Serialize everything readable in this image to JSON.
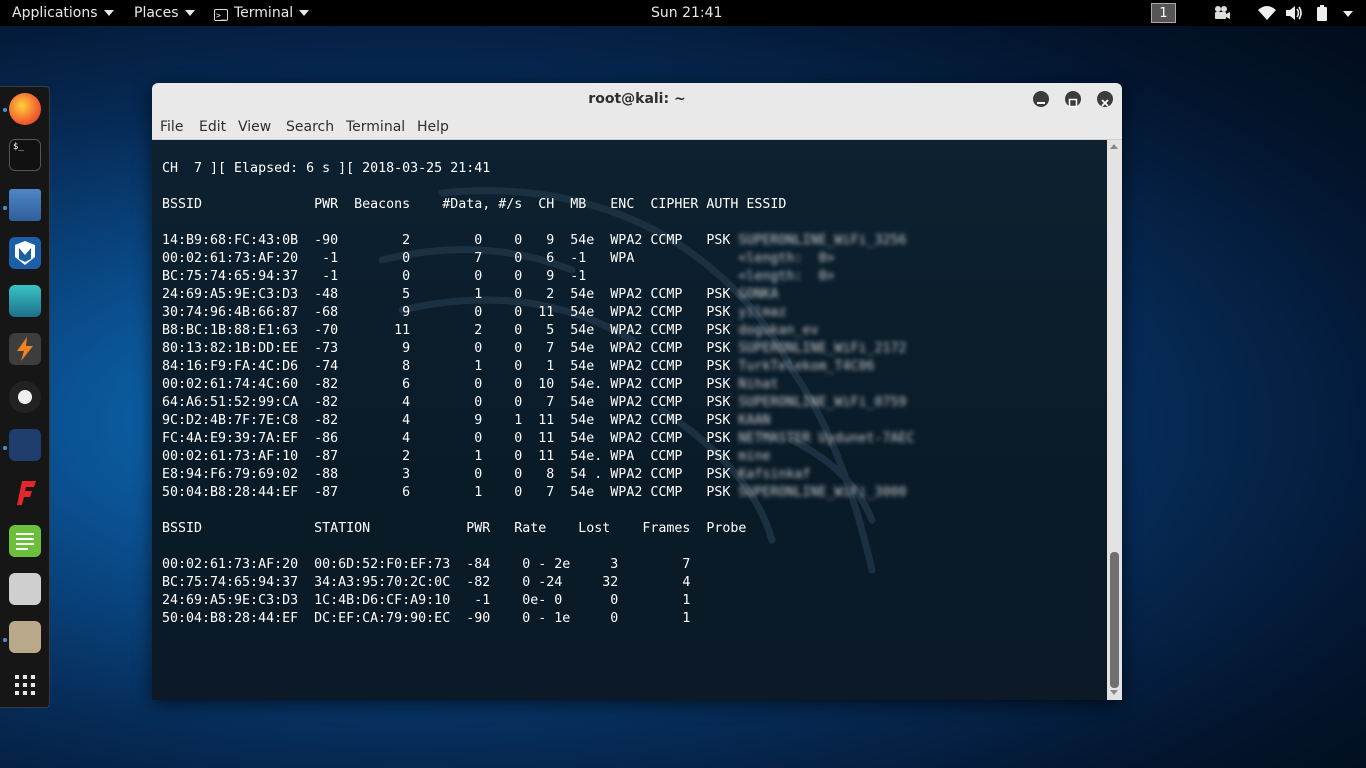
{
  "topbar": {
    "applications": "Applications",
    "places": "Places",
    "terminal": "Terminal",
    "clock": "Sun 21:41",
    "workspace": "1",
    "tray_icons": [
      "video-icon",
      "wifi-icon",
      "volume-icon",
      "battery-icon",
      "power-menu-icon"
    ]
  },
  "dock": {
    "items": [
      "firefox-icon",
      "terminal-icon",
      "files-icon",
      "metasploit-icon",
      "armitage-icon",
      "burpsuite-icon",
      "maltego-icon",
      "beef-icon",
      "faraday-icon",
      "leafpad-icon",
      "settings-icon",
      "gimp-icon",
      "app-grid-icon"
    ]
  },
  "window": {
    "title": "root@kali: ~",
    "menu": [
      "File",
      "Edit",
      "View",
      "Search",
      "Terminal",
      "Help"
    ]
  },
  "terminal": {
    "header": "CH  7 ][ Elapsed: 6 s ][ 2018-03-25 21:41",
    "ap_header": "BSSID              PWR  Beacons    #Data, #/s  CH  MB   ENC  CIPHER AUTH ESSID",
    "ap_rows": [
      {
        "text": "14:B9:68:FC:43:0B  -90        2        0    0   9  54e  WPA2 CCMP   PSK ",
        "essid": "SUPERONLINE_WiFi_3256"
      },
      {
        "text": "00:02:61:73:AF:20   -1        0        7    0   6  -1   WPA             ",
        "essid": "<length:  0>"
      },
      {
        "text": "BC:75:74:65:94:37   -1        0        0    0   9  -1                   ",
        "essid": "<length:  0>"
      },
      {
        "text": "24:69:A5:9E:C3:D3  -48        5        1    0   2  54e  WPA2 CCMP   PSK ",
        "essid": "GONKA"
      },
      {
        "text": "30:74:96:4B:66:87  -68        9        0    0  11  54e  WPA2 CCMP   PSK ",
        "essid": "yilmaz"
      },
      {
        "text": "B8:BC:1B:88:E1:63  -70       11        2    0   5  54e  WPA2 CCMP   PSK ",
        "essid": "dogukan_ev"
      },
      {
        "text": "80:13:82:1B:DD:EE  -73        9        0    0   7  54e  WPA2 CCMP   PSK ",
        "essid": "SUPERONLINE_WiFi_2172"
      },
      {
        "text": "84:16:F9:FA:4C:D6  -74        8        1    0   1  54e  WPA2 CCMP   PSK ",
        "essid": "TurkTelekom_T4C06"
      },
      {
        "text": "00:02:61:74:4C:60  -82        6        0    0  10  54e. WPA2 CCMP   PSK ",
        "essid": "Nihat"
      },
      {
        "text": "64:A6:51:52:99:CA  -82        4        0    0   7  54e  WPA2 CCMP   PSK ",
        "essid": "SUPERONLINE_WiFi_0759"
      },
      {
        "text": "9C:D2:4B:7F:7E:C8  -82        4        9    1  11  54e  WPA2 CCMP   PSK ",
        "essid": "KAAN"
      },
      {
        "text": "FC:4A:E9:39:7A:EF  -86        4        0    0  11  54e  WPA2 CCMP   PSK ",
        "essid": "NETMASTER Uydunet-7AEC"
      },
      {
        "text": "00:02:61:73:AF:10  -87        2        1    0  11  54e. WPA  CCMP   PSK ",
        "essid": "mine"
      },
      {
        "text": "E8:94:F6:79:69:02  -88        3        0    0   8  54 . WPA2 CCMP   PSK ",
        "essid": "Kafsinkaf"
      },
      {
        "text": "50:04:B8:28:44:EF  -87        6        1    0   7  54e  WPA2 CCMP   PSK ",
        "essid": "SUPERONLINE_WiFi_3000"
      }
    ],
    "st_header": "BSSID              STATION            PWR   Rate    Lost    Frames  Probe",
    "st_rows": [
      "00:02:61:73:AF:20  00:6D:52:F0:EF:73  -84    0 - 2e     3        7",
      "BC:75:74:65:94:37  34:A3:95:70:2C:0C  -82    0 -24     32        4",
      "24:69:A5:9E:C3:D3  1C:4B:D6:CF:A9:10   -1    0e- 0      0        1",
      "50:04:B8:28:44:EF  DC:EF:CA:79:90:EC  -90    0 - 1e     0        1"
    ]
  }
}
